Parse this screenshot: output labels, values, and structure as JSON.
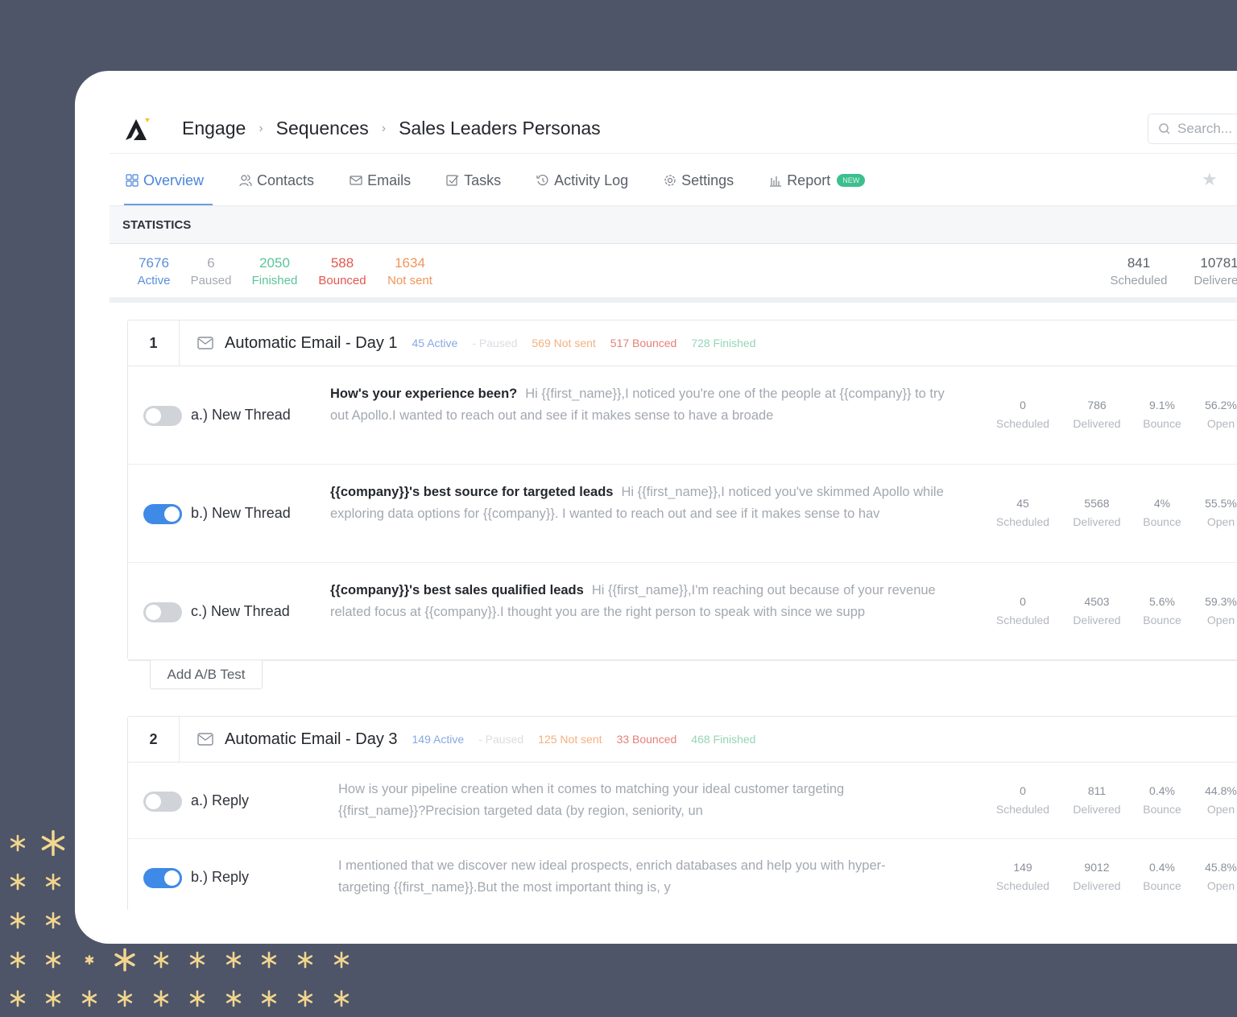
{
  "colors": {
    "background": "#4e5568",
    "accent": "#4b84d8",
    "active": "#5b8fd9",
    "paused": "#b8bcc2",
    "finished": "#5cc39a",
    "bounced": "#e0584f",
    "not_sent": "#f0955a",
    "new_badge": "#3cbf8e",
    "decoration": "#f3d68e"
  },
  "breadcrumb": [
    "Engage",
    "Sequences",
    "Sales Leaders Personas"
  ],
  "search": {
    "placeholder": "Search..."
  },
  "tabs": [
    {
      "label": "Overview",
      "icon": "grid-icon",
      "active": true
    },
    {
      "label": "Contacts",
      "icon": "users-icon"
    },
    {
      "label": "Emails",
      "icon": "mail-icon"
    },
    {
      "label": "Tasks",
      "icon": "checkbox-icon"
    },
    {
      "label": "Activity Log",
      "icon": "history-icon"
    },
    {
      "label": "Settings",
      "icon": "gear-icon"
    },
    {
      "label": "Report",
      "icon": "bar-chart-icon",
      "badge": "NEW"
    }
  ],
  "statistics": {
    "title": "STATISTICS",
    "left": [
      {
        "value": "7676",
        "label": "Active",
        "color": "#5b8fd9"
      },
      {
        "value": "6",
        "label": "Paused",
        "color": "#a5aab1"
      },
      {
        "value": "2050",
        "label": "Finished",
        "color": "#5cc39a"
      },
      {
        "value": "588",
        "label": "Bounced",
        "color": "#e0584f"
      },
      {
        "value": "1634",
        "label": "Not sent",
        "color": "#f0955a"
      }
    ],
    "right": [
      {
        "value": "841",
        "label": "Scheduled"
      },
      {
        "value": "10781",
        "label": "Delivered"
      }
    ]
  },
  "steps": [
    {
      "number": "1",
      "title": "Automatic Email - Day 1",
      "chips": [
        {
          "text": "45 Active",
          "color": "#86a9e3"
        },
        {
          "text": "- Paused",
          "color": "#dadde1"
        },
        {
          "text": "569 Not sent",
          "color": "#f4b07f"
        },
        {
          "text": "517 Bounced",
          "color": "#e57f78"
        },
        {
          "text": "728 Finished",
          "color": "#93d5b9"
        }
      ],
      "rows": [
        {
          "label": "a.) New Thread",
          "enabled": false,
          "subject": "How's your experience been?",
          "body": "Hi {{first_name}},I noticed you're one of the people at {{company}} to try out Apollo.I wanted to reach out and see if it makes sense to have a broade",
          "metrics": [
            {
              "v": "0",
              "l": "Scheduled"
            },
            {
              "v": "786",
              "l": "Delivered"
            },
            {
              "v": "9.1%",
              "l": "Bounce"
            },
            {
              "v": "56.2%",
              "l": "Open"
            }
          ]
        },
        {
          "label": "b.) New Thread",
          "enabled": true,
          "subject": "{{company}}'s best source for targeted leads",
          "body": "Hi {{first_name}},I noticed you've skimmed Apollo while exploring data options for {{company}}. I wanted to reach out and see if it makes sense to hav",
          "metrics": [
            {
              "v": "45",
              "l": "Scheduled"
            },
            {
              "v": "5568",
              "l": "Delivered"
            },
            {
              "v": "4%",
              "l": "Bounce"
            },
            {
              "v": "55.5%",
              "l": "Open"
            }
          ]
        },
        {
          "label": "c.) New Thread",
          "enabled": false,
          "subject": "{{company}}'s best sales qualified leads",
          "body": "Hi {{first_name}},I'm reaching out because of your revenue related focus at {{company}}.I thought you are the right person to speak with since we supp",
          "metrics": [
            {
              "v": "0",
              "l": "Scheduled"
            },
            {
              "v": "4503",
              "l": "Delivered"
            },
            {
              "v": "5.6%",
              "l": "Bounce"
            },
            {
              "v": "59.3%",
              "l": "Open"
            }
          ]
        }
      ],
      "add_ab_test": "Add A/B Test"
    },
    {
      "number": "2",
      "title": "Automatic Email - Day 3",
      "chips": [
        {
          "text": "149 Active",
          "color": "#86a9e3"
        },
        {
          "text": "- Paused",
          "color": "#dadde1"
        },
        {
          "text": "125 Not sent",
          "color": "#f4b07f"
        },
        {
          "text": "33 Bounced",
          "color": "#e57f78"
        },
        {
          "text": "468 Finished",
          "color": "#93d5b9"
        }
      ],
      "rows": [
        {
          "label": "a.) Reply",
          "enabled": false,
          "subject": "",
          "body": "How is your pipeline creation when it comes to matching your ideal customer targeting {{first_name}}?Precision targeted data (by region, seniority, un",
          "metrics": [
            {
              "v": "0",
              "l": "Scheduled"
            },
            {
              "v": "811",
              "l": "Delivered"
            },
            {
              "v": "0.4%",
              "l": "Bounce"
            },
            {
              "v": "44.8%",
              "l": "Open"
            }
          ]
        },
        {
          "label": "b.) Reply",
          "enabled": true,
          "subject": "",
          "body": "I mentioned that we discover new ideal prospects, enrich databases and help you with hyper-targeting {{first_name}}.But the most important thing is, y",
          "metrics": [
            {
              "v": "149",
              "l": "Scheduled"
            },
            {
              "v": "9012",
              "l": "Delivered"
            },
            {
              "v": "0.4%",
              "l": "Bounce"
            },
            {
              "v": "45.8%",
              "l": "Open"
            }
          ]
        }
      ]
    }
  ]
}
